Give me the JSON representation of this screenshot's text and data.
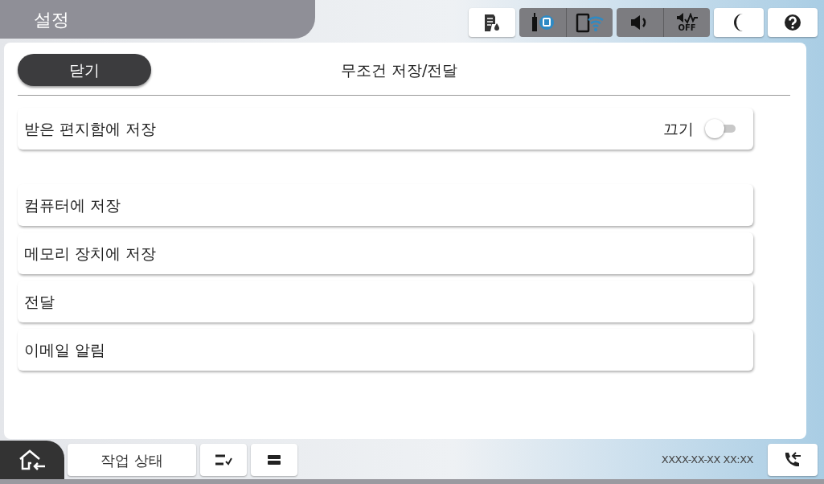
{
  "header": {
    "title": "설정",
    "mute_label": "OFF"
  },
  "panel": {
    "close_button": "닫기",
    "title": "무조건 저장/전달"
  },
  "items": [
    {
      "kind": "toggle",
      "label": "받은 편지함에 저장",
      "state_label": "끄기",
      "on": false
    },
    {
      "kind": "gap"
    },
    {
      "kind": "link",
      "label": "컴퓨터에 저장"
    },
    {
      "kind": "link",
      "label": "메모리 장치에 저장"
    },
    {
      "kind": "link",
      "label": "전달"
    },
    {
      "kind": "link",
      "label": "이메일 알림"
    }
  ],
  "footer": {
    "job_status_button": "작업 상태",
    "datetime": "XXXX-XX-XX XX:XX"
  }
}
